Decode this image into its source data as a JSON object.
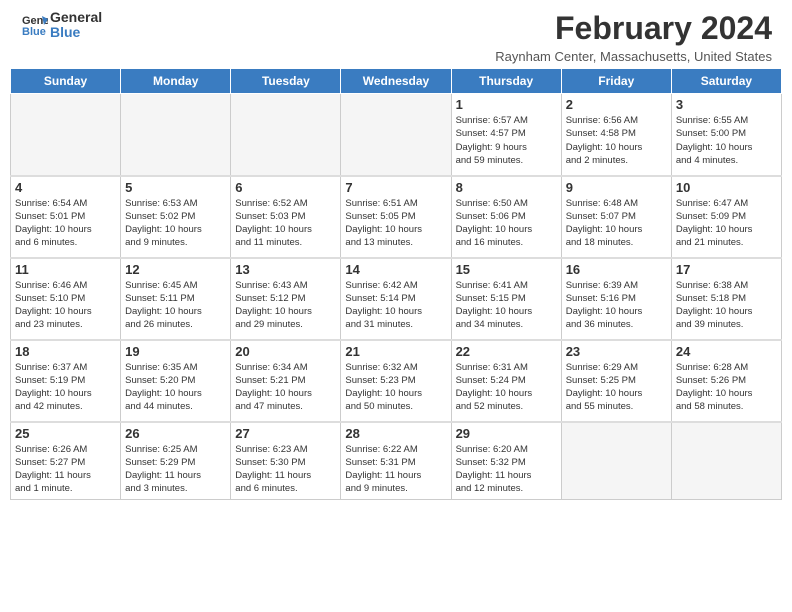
{
  "header": {
    "logo_line1": "General",
    "logo_line2": "Blue",
    "title": "February 2024",
    "location": "Raynham Center, Massachusetts, United States"
  },
  "days_of_week": [
    "Sunday",
    "Monday",
    "Tuesday",
    "Wednesday",
    "Thursday",
    "Friday",
    "Saturday"
  ],
  "weeks": [
    [
      {
        "date": "",
        "detail": ""
      },
      {
        "date": "",
        "detail": ""
      },
      {
        "date": "",
        "detail": ""
      },
      {
        "date": "",
        "detail": ""
      },
      {
        "date": "1",
        "detail": "Sunrise: 6:57 AM\nSunset: 4:57 PM\nDaylight: 9 hours\nand 59 minutes."
      },
      {
        "date": "2",
        "detail": "Sunrise: 6:56 AM\nSunset: 4:58 PM\nDaylight: 10 hours\nand 2 minutes."
      },
      {
        "date": "3",
        "detail": "Sunrise: 6:55 AM\nSunset: 5:00 PM\nDaylight: 10 hours\nand 4 minutes."
      }
    ],
    [
      {
        "date": "4",
        "detail": "Sunrise: 6:54 AM\nSunset: 5:01 PM\nDaylight: 10 hours\nand 6 minutes."
      },
      {
        "date": "5",
        "detail": "Sunrise: 6:53 AM\nSunset: 5:02 PM\nDaylight: 10 hours\nand 9 minutes."
      },
      {
        "date": "6",
        "detail": "Sunrise: 6:52 AM\nSunset: 5:03 PM\nDaylight: 10 hours\nand 11 minutes."
      },
      {
        "date": "7",
        "detail": "Sunrise: 6:51 AM\nSunset: 5:05 PM\nDaylight: 10 hours\nand 13 minutes."
      },
      {
        "date": "8",
        "detail": "Sunrise: 6:50 AM\nSunset: 5:06 PM\nDaylight: 10 hours\nand 16 minutes."
      },
      {
        "date": "9",
        "detail": "Sunrise: 6:48 AM\nSunset: 5:07 PM\nDaylight: 10 hours\nand 18 minutes."
      },
      {
        "date": "10",
        "detail": "Sunrise: 6:47 AM\nSunset: 5:09 PM\nDaylight: 10 hours\nand 21 minutes."
      }
    ],
    [
      {
        "date": "11",
        "detail": "Sunrise: 6:46 AM\nSunset: 5:10 PM\nDaylight: 10 hours\nand 23 minutes."
      },
      {
        "date": "12",
        "detail": "Sunrise: 6:45 AM\nSunset: 5:11 PM\nDaylight: 10 hours\nand 26 minutes."
      },
      {
        "date": "13",
        "detail": "Sunrise: 6:43 AM\nSunset: 5:12 PM\nDaylight: 10 hours\nand 29 minutes."
      },
      {
        "date": "14",
        "detail": "Sunrise: 6:42 AM\nSunset: 5:14 PM\nDaylight: 10 hours\nand 31 minutes."
      },
      {
        "date": "15",
        "detail": "Sunrise: 6:41 AM\nSunset: 5:15 PM\nDaylight: 10 hours\nand 34 minutes."
      },
      {
        "date": "16",
        "detail": "Sunrise: 6:39 AM\nSunset: 5:16 PM\nDaylight: 10 hours\nand 36 minutes."
      },
      {
        "date": "17",
        "detail": "Sunrise: 6:38 AM\nSunset: 5:18 PM\nDaylight: 10 hours\nand 39 minutes."
      }
    ],
    [
      {
        "date": "18",
        "detail": "Sunrise: 6:37 AM\nSunset: 5:19 PM\nDaylight: 10 hours\nand 42 minutes."
      },
      {
        "date": "19",
        "detail": "Sunrise: 6:35 AM\nSunset: 5:20 PM\nDaylight: 10 hours\nand 44 minutes."
      },
      {
        "date": "20",
        "detail": "Sunrise: 6:34 AM\nSunset: 5:21 PM\nDaylight: 10 hours\nand 47 minutes."
      },
      {
        "date": "21",
        "detail": "Sunrise: 6:32 AM\nSunset: 5:23 PM\nDaylight: 10 hours\nand 50 minutes."
      },
      {
        "date": "22",
        "detail": "Sunrise: 6:31 AM\nSunset: 5:24 PM\nDaylight: 10 hours\nand 52 minutes."
      },
      {
        "date": "23",
        "detail": "Sunrise: 6:29 AM\nSunset: 5:25 PM\nDaylight: 10 hours\nand 55 minutes."
      },
      {
        "date": "24",
        "detail": "Sunrise: 6:28 AM\nSunset: 5:26 PM\nDaylight: 10 hours\nand 58 minutes."
      }
    ],
    [
      {
        "date": "25",
        "detail": "Sunrise: 6:26 AM\nSunset: 5:27 PM\nDaylight: 11 hours\nand 1 minute."
      },
      {
        "date": "26",
        "detail": "Sunrise: 6:25 AM\nSunset: 5:29 PM\nDaylight: 11 hours\nand 3 minutes."
      },
      {
        "date": "27",
        "detail": "Sunrise: 6:23 AM\nSunset: 5:30 PM\nDaylight: 11 hours\nand 6 minutes."
      },
      {
        "date": "28",
        "detail": "Sunrise: 6:22 AM\nSunset: 5:31 PM\nDaylight: 11 hours\nand 9 minutes."
      },
      {
        "date": "29",
        "detail": "Sunrise: 6:20 AM\nSunset: 5:32 PM\nDaylight: 11 hours\nand 12 minutes."
      },
      {
        "date": "",
        "detail": ""
      },
      {
        "date": "",
        "detail": ""
      }
    ]
  ]
}
